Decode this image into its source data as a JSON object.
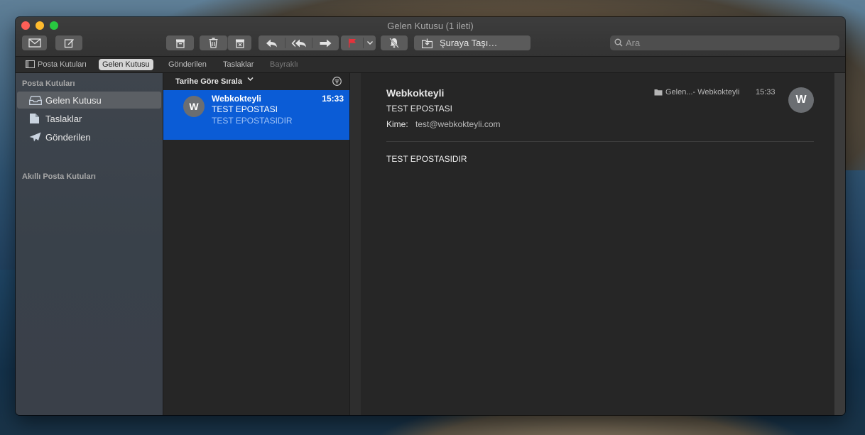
{
  "window": {
    "title": "Gelen Kutusu (1 ileti)"
  },
  "toolbar": {
    "move_label": "Şuraya Taşı…",
    "search_placeholder": "Ara",
    "flag_color": "#e5323b"
  },
  "favorites": {
    "mailboxes": "Posta Kutuları",
    "inbox": "Gelen Kutusu",
    "sent": "Gönderilen",
    "drafts": "Taslaklar",
    "flagged": "Bayraklı"
  },
  "sidebar": {
    "section_mailboxes": "Posta Kutuları",
    "items": [
      {
        "label": "Gelen Kutusu",
        "icon": "inbox-icon",
        "selected": true
      },
      {
        "label": "Taslaklar",
        "icon": "draft-icon",
        "selected": false
      },
      {
        "label": "Gönderilen",
        "icon": "sent-icon",
        "selected": false
      }
    ],
    "section_smart": "Akıllı Posta Kutuları"
  },
  "list": {
    "sort_label": "Tarihe Göre Sırala",
    "messages": [
      {
        "avatar": "W",
        "from": "Webkokteyli",
        "time": "15:33",
        "subject": "TEST EPOSTASI",
        "preview": "TEST EPOSTASIDIR"
      }
    ]
  },
  "reader": {
    "from": "Webkokteyli",
    "subject": "TEST EPOSTASI",
    "to_label": "Kime:",
    "to": "test@webkokteyli.com",
    "folder": "Gelen...- Webkokteyli",
    "time": "15:33",
    "avatar": "W",
    "body": "TEST EPOSTASIDIR"
  }
}
